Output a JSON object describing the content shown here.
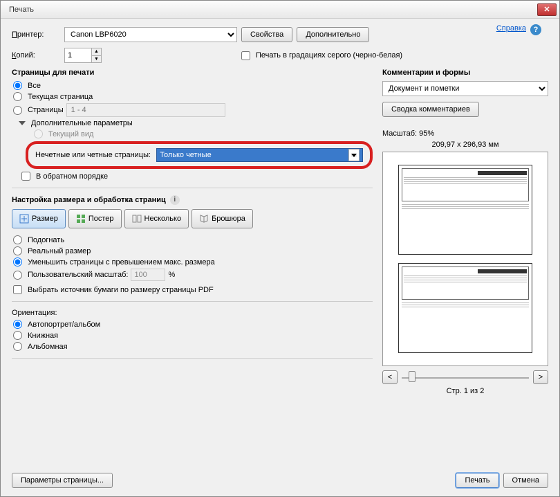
{
  "window": {
    "title": "Печать"
  },
  "header": {
    "printer_label": "Принтер:",
    "printer_value": "Canon LBP6020",
    "properties_btn": "Свойства",
    "advanced_btn": "Дополнительно",
    "help_link": "Справка",
    "copies_label": "Копий:",
    "copies_value": "1",
    "grayscale_label": "Печать в градациях серого (черно-белая)"
  },
  "pages": {
    "heading": "Страницы для печати",
    "all": "Все",
    "current": "Текущая страница",
    "pages_label": "Страницы",
    "pages_placeholder": "1 - 4",
    "more_params": "Дополнительные параметры",
    "current_view": "Текущий вид",
    "odd_even_label": "Нечетные или четные страницы:",
    "odd_even_value": "Только четные",
    "reverse": "В обратном порядке"
  },
  "sizing": {
    "heading": "Настройка размера и обработка страниц",
    "tabs": {
      "size": "Размер",
      "poster": "Постер",
      "multiple": "Несколько",
      "booklet": "Брошюра"
    },
    "fit": "Подогнать",
    "actual": "Реальный размер",
    "shrink": "Уменьшить страницы с превышением макс. размера",
    "custom": "Пользовательский масштаб:",
    "custom_value": "100",
    "percent": "%",
    "paper_source": "Выбрать источник бумаги по размеру страницы PDF"
  },
  "orientation": {
    "heading": "Ориентация:",
    "auto": "Автопортрет/альбом",
    "portrait": "Книжная",
    "landscape": "Альбомная"
  },
  "right": {
    "comments_heading": "Комментарии и формы",
    "comments_value": "Документ и пометки",
    "summary_btn": "Сводка комментариев",
    "scale": "Масштаб:  95%",
    "dims": "209,97 x 296,93 мм",
    "page_n": "Стр. 1 из 2",
    "prev": "<",
    "next": ">"
  },
  "footer": {
    "page_setup": "Параметры страницы...",
    "print": "Печать",
    "cancel": "Отмена"
  }
}
